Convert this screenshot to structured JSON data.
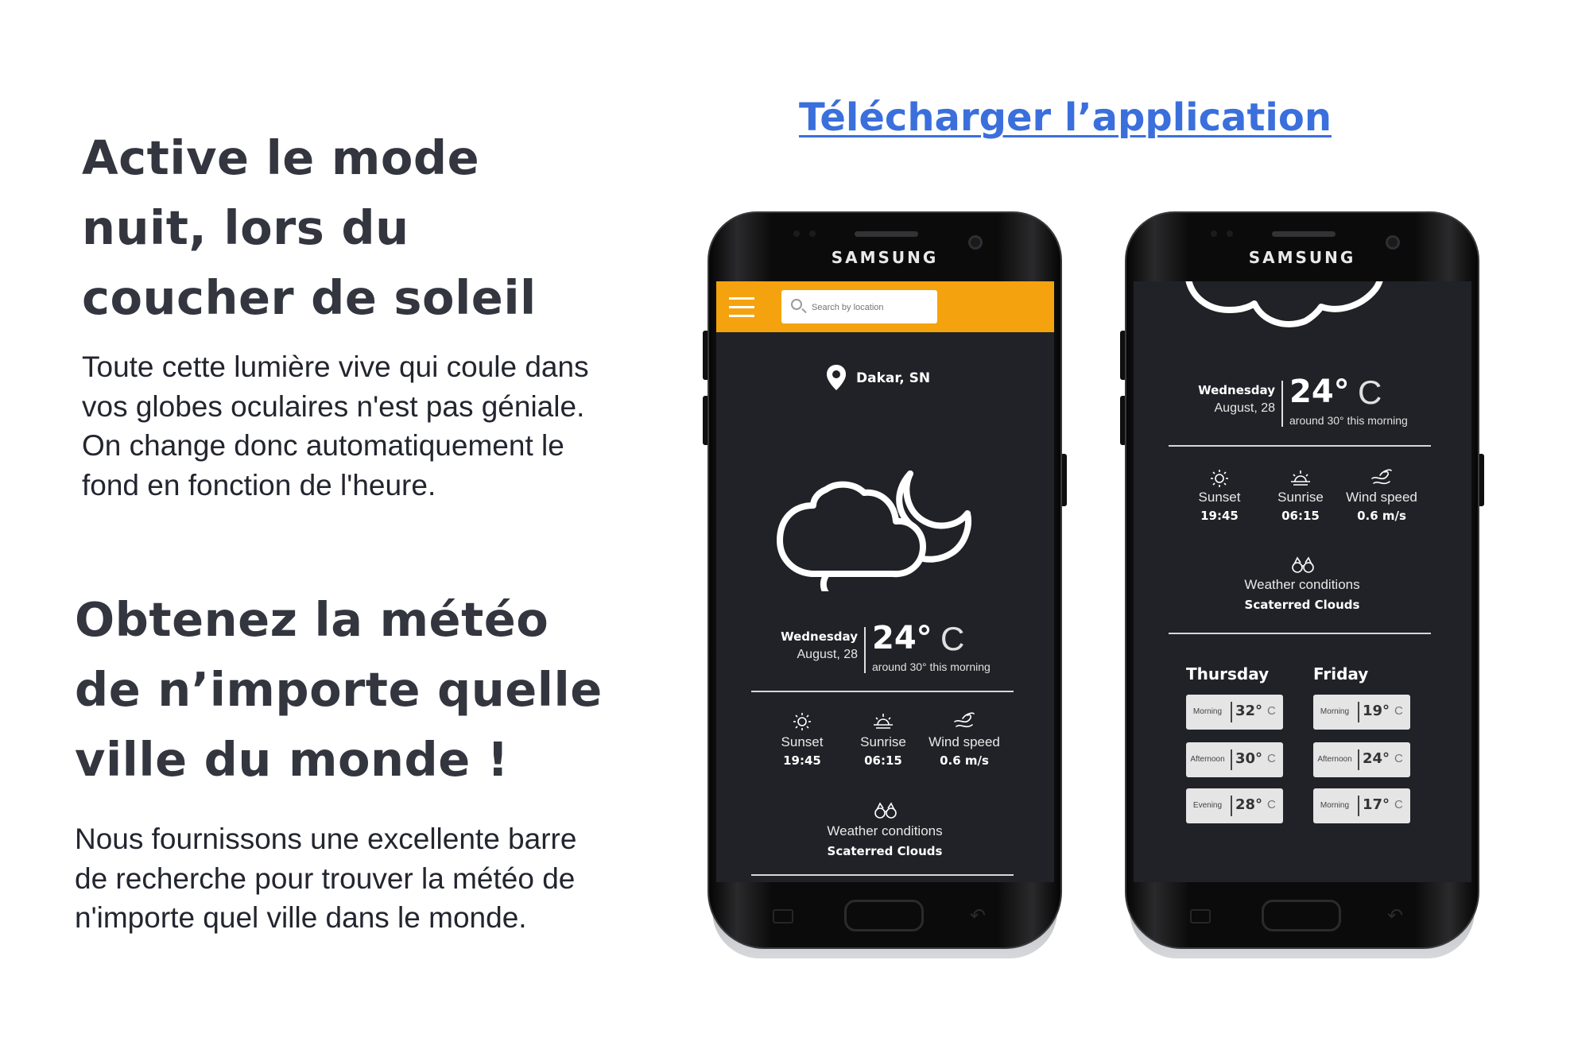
{
  "left": {
    "heading1": "Active le mode nuit, lors du coucher de soleil",
    "para1": "Toute cette lumière vive qui coule dans vos globes oculaires n'est pas géniale. On change donc automatiquement le fond en fonction de l'heure.",
    "heading2": "Obtenez la météo de n’importe quelle ville du monde !",
    "para2": "Nous fournissons une excellente barre de recherche pour trouver la météo de n'importe quel ville dans le monde."
  },
  "download_link": "Télécharger l’application",
  "phone_brand": "SAMSUNG",
  "colors": {
    "accent": "#f5a20f",
    "link": "#3a6fdc",
    "screen_bg": "#212227"
  },
  "app": {
    "search_placeholder": "Search by location",
    "location": "Dakar, SN",
    "day": "Wednesday",
    "date": "August, 28",
    "temp": "24°",
    "unit": "C",
    "temp_note": "around 30° this morning",
    "stats": [
      {
        "icon": "sun-icon",
        "label": "Sunset",
        "value": "19:45"
      },
      {
        "icon": "sunrise-icon",
        "label": "Sunrise",
        "value": "06:15"
      },
      {
        "icon": "wind-icon",
        "label": "Wind speed",
        "value": "0.6 m/s"
      }
    ],
    "conditions_label": "Weather conditions",
    "conditions_value": "Scaterred Clouds",
    "forecast": [
      {
        "day": "Thursday",
        "periods": [
          {
            "label": "Morning",
            "temp": "32°",
            "unit": "C"
          },
          {
            "label": "Afternoon",
            "temp": "30°",
            "unit": "C"
          },
          {
            "label": "Evening",
            "temp": "28°",
            "unit": "C"
          }
        ]
      },
      {
        "day": "Friday",
        "periods": [
          {
            "label": "Morning",
            "temp": "19°",
            "unit": "C"
          },
          {
            "label": "Afternoon",
            "temp": "24°",
            "unit": "C"
          },
          {
            "label": "Morning",
            "temp": "17°",
            "unit": "C"
          }
        ]
      }
    ]
  }
}
